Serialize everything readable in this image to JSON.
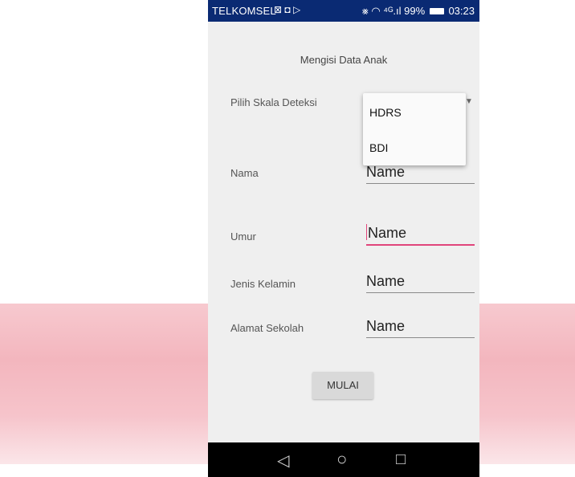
{
  "status_bar": {
    "carrier": "TELKOMSEL",
    "notification_icons": "⊠ ◘ ▷",
    "signal_icons": "⨳ ◠ ⁴ᴳ.ıl",
    "battery": "99%",
    "time": "03:23"
  },
  "screen": {
    "title": "Mengisi Data Anak",
    "scale_label": "Pilih Skala Deteksi",
    "dropdown_options": [
      "HDRS",
      "BDI"
    ],
    "fields": [
      {
        "label": "Nama",
        "value": "Name"
      },
      {
        "label": "Umur",
        "value": "Name"
      },
      {
        "label": "Jenis Kelamin",
        "value": "Name"
      },
      {
        "label": "Alamat Sekolah",
        "value": "Name"
      }
    ],
    "start_button": "MULAI"
  },
  "nav": {
    "back_icon": "◁",
    "home_icon": "○",
    "recent_icon": "□"
  },
  "colors": {
    "status_bar": "#0a2a73",
    "accent": "#e0457b",
    "background_band": "#f3b6be"
  }
}
